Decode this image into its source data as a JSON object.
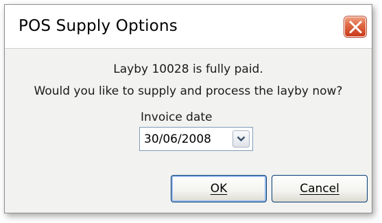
{
  "window": {
    "title": "POS Supply Options",
    "close_icon": "close-icon"
  },
  "message": {
    "line1": "Layby 10028 is fully paid.",
    "line2": "Would you like to supply and process the layby now?"
  },
  "invoice": {
    "label": "Invoice date",
    "value": "30/06/2008",
    "dropdown_icon": "chevron-down-icon"
  },
  "buttons": {
    "ok_label": "OK",
    "cancel_label": "Cancel"
  },
  "colors": {
    "close_button": "#d9512c",
    "button_border": "#003c74"
  }
}
